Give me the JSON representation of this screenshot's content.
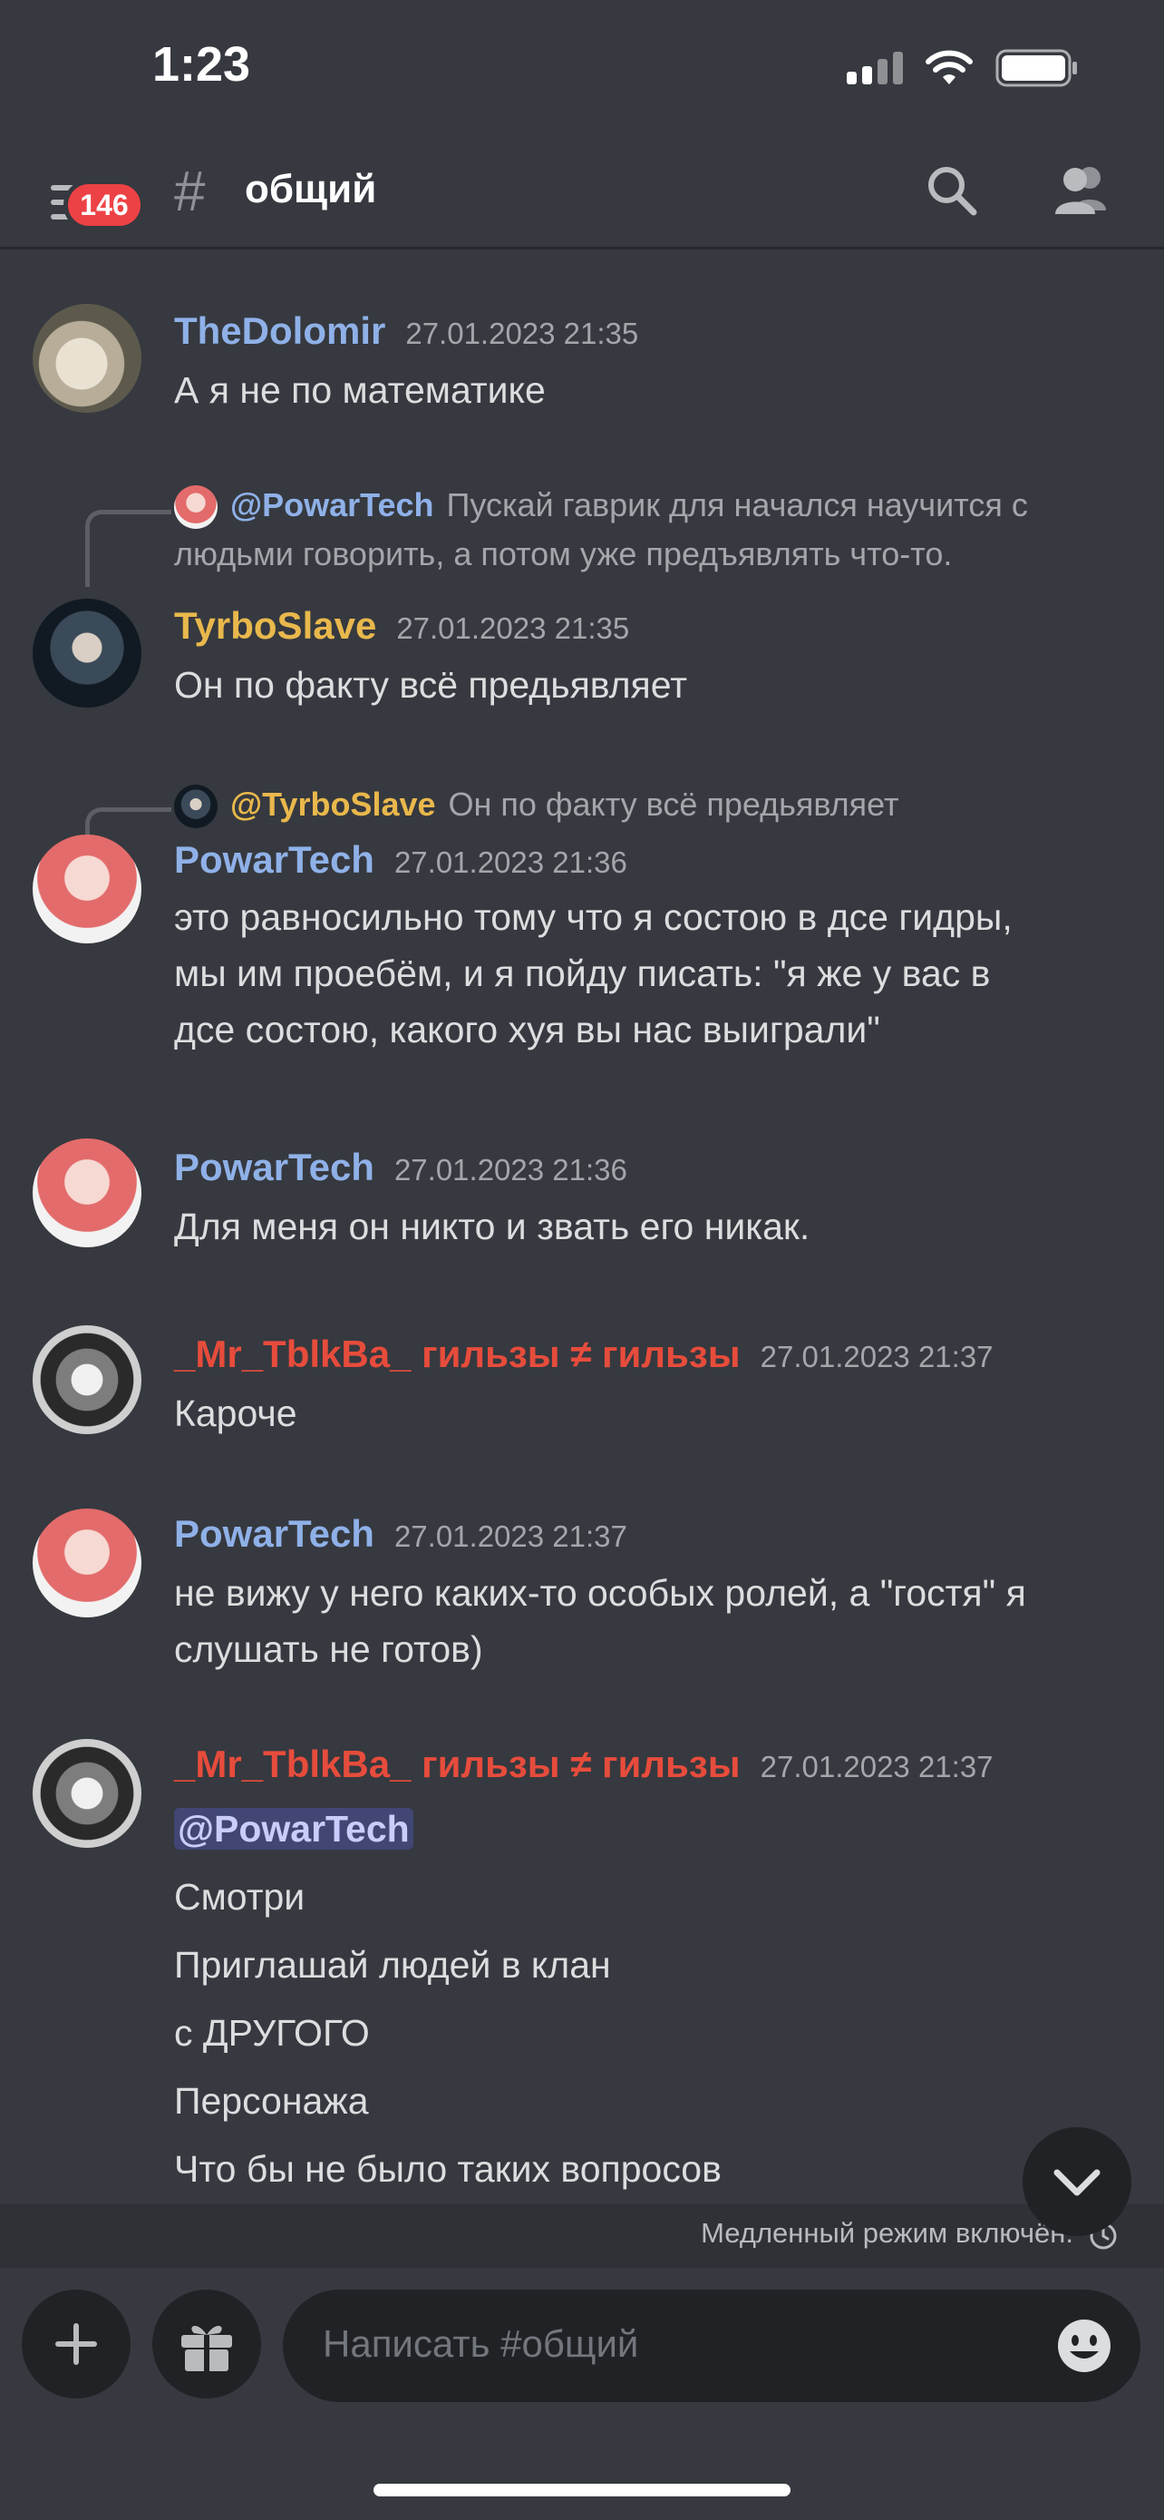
{
  "status_bar": {
    "time": "1:23"
  },
  "header": {
    "badge": "146",
    "hash": "#",
    "channel": "общий"
  },
  "messages": [
    {
      "user": "TheDolomir",
      "time": "27.01.2023 21:35",
      "lines": [
        "А я не по математике"
      ]
    },
    {
      "reply_user": "@PowarTech",
      "reply_text": "Пускай гаврик для начался научится с людьми говорить, а потом уже предъявлять что-то.",
      "user": "TyrboSlave",
      "time": "27.01.2023 21:35",
      "lines": [
        "Он по факту всё предьявляет"
      ]
    },
    {
      "reply_user": "@TyrboSlave",
      "reply_text": "Он по факту всё предьявляет",
      "user": "PowarTech",
      "time": "27.01.2023 21:36",
      "lines": [
        "это равносильно тому что я состою в дсе гидры,",
        "мы им проебём, и я пойду писать: \"я же у вас в",
        "дсе состою, какого хуя вы нас выиграли\""
      ]
    },
    {
      "user": "PowarTech",
      "time": "27.01.2023 21:36",
      "lines": [
        "Для меня он никто и звать его никак."
      ]
    },
    {
      "user": "_Mr_TblkBa_ гильзы ≠ гильзы",
      "time": "27.01.2023 21:37",
      "lines": [
        "Кароче"
      ]
    },
    {
      "user": "PowarTech",
      "time": "27.01.2023 21:37",
      "lines": [
        "не вижу у него каких-то особых ролей, а \"гостя\" я",
        "слушать не готов)"
      ]
    },
    {
      "user": "_Mr_TblkBa_ гильзы ≠ гильзы",
      "time": "27.01.2023 21:37",
      "mention": "@PowarTech",
      "lines": [
        "Смотри",
        "Приглашай людей в клан",
        "с ДРУГОГО",
        "Персонажа",
        "Что бы не было таких вопросов"
      ]
    }
  ],
  "slow_mode": "Медленный режим включён.",
  "composer": {
    "placeholder": "Написать #общий"
  },
  "colors": {
    "background": "#36393f",
    "thedolomir": "#8fb1e8",
    "tyrboslave": "#e9b84c",
    "powartech": "#8fb1e8",
    "mrtblkba": "#e74c3c",
    "badge": "#ed4245"
  },
  "icons": [
    "menu-icon",
    "search-icon",
    "members-icon",
    "plus-icon",
    "gift-icon",
    "emoji-icon",
    "chevron-down-icon",
    "clock-icon"
  ]
}
